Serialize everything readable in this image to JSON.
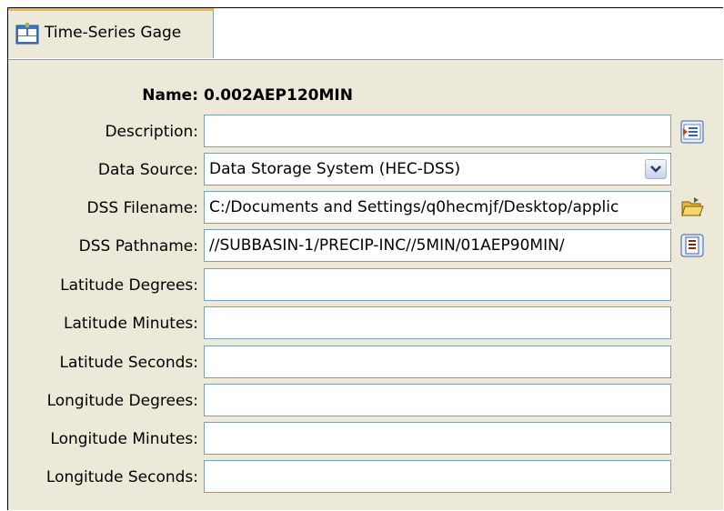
{
  "tab": {
    "label": "Time-Series Gage",
    "icon": "gage-icon",
    "accent": "#f5b642"
  },
  "form": {
    "name_label": "Name:",
    "name_value": "0.002AEP120MIN",
    "fields": [
      {
        "label": "Description:",
        "value": ""
      },
      {
        "label": "Data Source:",
        "value": "Data Storage System (HEC-DSS)"
      },
      {
        "label": "DSS Filename:",
        "value": "C:/Documents and Settings/q0hecmjf/Desktop/applic"
      },
      {
        "label": "DSS Pathname:",
        "value": "//SUBBASIN-1/PRECIP-INC//5MIN/01AEP90MIN/"
      },
      {
        "label": "Latitude Degrees:",
        "value": ""
      },
      {
        "label": "Latitude Minutes:",
        "value": ""
      },
      {
        "label": "Latitude Seconds:",
        "value": ""
      },
      {
        "label": "Longitude Degrees:",
        "value": ""
      },
      {
        "label": "Longitude Minutes:",
        "value": ""
      },
      {
        "label": "Longitude Seconds:",
        "value": ""
      }
    ]
  },
  "icons": {
    "description_button": "edit-description-icon",
    "data_source_dropdown": "chevron-down-icon",
    "filename_button": "open-folder-icon",
    "pathname_button": "select-pathname-icon"
  }
}
